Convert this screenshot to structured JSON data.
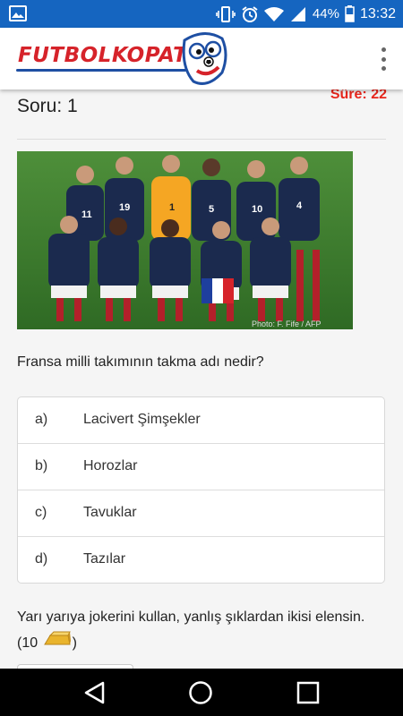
{
  "status_bar": {
    "battery": "44%",
    "time": "13:32"
  },
  "app": {
    "logo_text": "FUTBOLKOPAT"
  },
  "quiz": {
    "timer": "Süre: 22",
    "question_number": "Soru: 1",
    "photo_credit": "Photo: F. Fife / AFP",
    "question": "Fransa milli takımının takma adı nedir?",
    "answers": [
      {
        "letter": "a)",
        "text": "Lacivert Şimşekler"
      },
      {
        "letter": "b)",
        "text": "Horozlar"
      },
      {
        "letter": "c)",
        "text": "Tavuklar"
      },
      {
        "letter": "d)",
        "text": "Tazılar"
      }
    ],
    "joker_text_before": "Yarı yarıya jokerini kullan, yanlış şıklardan ikisi elensin. (10",
    "joker_text_after": ")"
  },
  "colors": {
    "status_bar": "#1565c0",
    "logo_red": "#d6232a",
    "timer_red": "#e8261c"
  },
  "icons": {
    "gallery": "gallery-icon",
    "vibrate": "vibrate-icon",
    "alarm": "alarm-icon",
    "wifi": "wifi-icon",
    "signal": "signal-icon",
    "battery": "battery-icon",
    "menu": "more-vert-icon",
    "gold": "gold-bar-icon",
    "back": "back-icon",
    "home": "home-icon",
    "recents": "recents-icon"
  }
}
